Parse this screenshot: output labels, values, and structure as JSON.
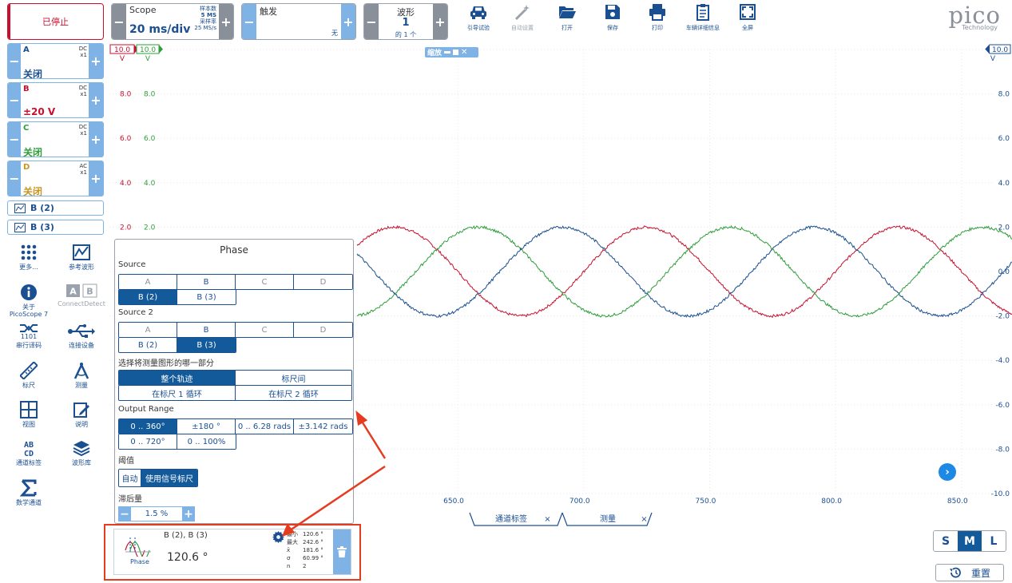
{
  "toolbar": {
    "stop_label": "已停止",
    "scope": {
      "title": "Scope",
      "value": "20 ms/div",
      "samples_label": "样本数",
      "samples_value": "5 MS",
      "rate_label": "采样率",
      "rate_value": "25 MS/s"
    },
    "trigger": {
      "title": "触发",
      "mode": "无"
    },
    "waveform": {
      "title": "波形",
      "value": "1",
      "sub": "的 1 个"
    },
    "tools": [
      {
        "label": "引导试验",
        "icon": "car-icon",
        "enabled": true
      },
      {
        "label": "自动设置",
        "icon": "wand-icon",
        "enabled": false
      },
      {
        "label": "打开",
        "icon": "folder-icon",
        "enabled": true
      },
      {
        "label": "保存",
        "icon": "save-icon",
        "enabled": true
      },
      {
        "label": "打印",
        "icon": "printer-icon",
        "enabled": true
      },
      {
        "label": "车辆详细信息",
        "icon": "clipboard-icon",
        "enabled": true
      },
      {
        "label": "全屏",
        "icon": "fullscreen-icon",
        "enabled": true
      }
    ],
    "logo": {
      "word": "pico",
      "sub": "Technology"
    }
  },
  "channels": [
    {
      "name": "A",
      "coupling": "DC",
      "probe": "x1",
      "range": "关闭",
      "color": "#1a4f91"
    },
    {
      "name": "B",
      "coupling": "DC",
      "probe": "x1",
      "range": "±20 V",
      "color": "#c8102e"
    },
    {
      "name": "C",
      "coupling": "DC",
      "probe": "x1",
      "range": "关闭",
      "color": "#2e9e3a"
    },
    {
      "name": "D",
      "coupling": "AC",
      "probe": "x1",
      "range": "关闭",
      "color": "#c8961e"
    }
  ],
  "refs": [
    "B (2)",
    "B (3)"
  ],
  "side_tools": [
    {
      "label": "更多...",
      "icon": "more-icon"
    },
    {
      "label": "参考波形",
      "icon": "reference-waveform-icon"
    },
    {
      "label": "关于\nPicoScope 7",
      "icon": "info-icon"
    },
    {
      "label": "ConnectDetect",
      "icon": "connect-detect-icon",
      "enabled": false
    },
    {
      "label": "串行译码",
      "icon": "serial-decode-icon"
    },
    {
      "label": "连接设备",
      "icon": "usb-icon"
    },
    {
      "label": "标尺",
      "icon": "ruler-icon"
    },
    {
      "label": "测量",
      "icon": "compass-icon"
    },
    {
      "label": "视图",
      "icon": "view-grid-icon"
    },
    {
      "label": "说明",
      "icon": "notes-icon"
    },
    {
      "label": "通道标签",
      "icon": "channel-labels-icon"
    },
    {
      "label": "波形库",
      "icon": "waveform-library-icon"
    },
    {
      "label": "数学通道",
      "icon": "sigma-icon"
    }
  ],
  "plot": {
    "zoom_label": "缩放",
    "left_top_red": "10.0",
    "left_top_green": "10.0",
    "right_top": "10.0",
    "left_ticks": [
      "8.0",
      "6.0",
      "4.0",
      "2.0"
    ],
    "right_ticks": [
      "8.0",
      "6.0",
      "4.0",
      "2.0",
      "0.0",
      "-2.0",
      "-4.0",
      "-6.0",
      "-8.0",
      "-10.0"
    ],
    "x_ticks": [
      "650.0",
      "700.0",
      "750.0",
      "800.0",
      "850.0"
    ],
    "unit_v": "V",
    "colors": {
      "a": "#1a4f91",
      "b": "#c8102e",
      "c": "#2e9e3a"
    }
  },
  "chart_data": {
    "type": "line",
    "x_range": [
      610,
      870
    ],
    "ylim": [
      -10,
      10
    ],
    "series": [
      {
        "name": "B",
        "color": "#c8102e",
        "amplitude": 2.0,
        "period": 100,
        "phase_deg": 0
      },
      {
        "name": "B (2)",
        "color": "#2e9e3a",
        "amplitude": 2.0,
        "period": 100,
        "phase_deg": 120
      },
      {
        "name": "B (3)",
        "color": "#1a4f91",
        "amplitude": 2.0,
        "period": 100,
        "phase_deg": 240
      }
    ]
  },
  "phase_panel": {
    "title": "Phase",
    "source_label": "Source",
    "source_row1": [
      "A",
      "B",
      "C",
      "D"
    ],
    "source_row2": [
      "B (2)",
      "B (3)"
    ],
    "source2_label": "Source 2",
    "source2_row1": [
      "A",
      "B",
      "C",
      "D"
    ],
    "source2_row2": [
      "B (2)",
      "B (3)"
    ],
    "part_label": "选择将测量图形的哪一部分",
    "part_row1": [
      "整个轨迹",
      "标尺间"
    ],
    "part_row2": [
      "在标尺 1 循环",
      "在标尺 2 循环"
    ],
    "range_label": "Output Range",
    "range_row1": [
      "0 .. 360°",
      "±180 °",
      "0 .. 6.28 rads",
      "±3.142 rads"
    ],
    "range_row2": [
      "0 .. 720°",
      "0 .. 100%"
    ],
    "threshold_label": "阈值",
    "threshold_opts": [
      "自动",
      "使用信号标尺"
    ],
    "hyst_label": "滞后量",
    "hyst_value": "1.5 %"
  },
  "measurement": {
    "sources": "B (2), B (3)",
    "value": "120.6 °",
    "name": "Phase",
    "stats": [
      {
        "k": "最小",
        "v": "120.6 °"
      },
      {
        "k": "最大",
        "v": "242.6 °"
      },
      {
        "k": "x̄",
        "v": "181.6 °"
      },
      {
        "k": "σ",
        "v": "60.99 °"
      },
      {
        "k": "n",
        "v": "2"
      }
    ]
  },
  "tabs": [
    {
      "label": "通道标签"
    },
    {
      "label": "测量"
    }
  ],
  "size_opts": [
    "S",
    "M",
    "L"
  ],
  "reset_label": "重置"
}
